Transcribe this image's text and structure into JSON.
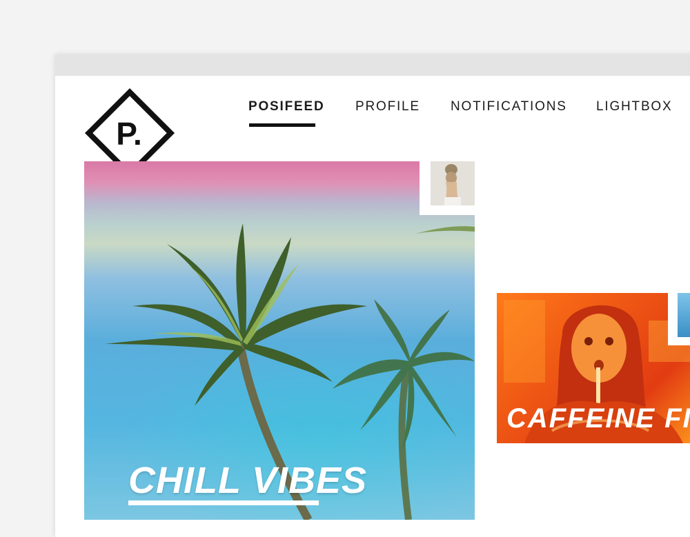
{
  "brand": {
    "logo_letter": "P."
  },
  "nav": {
    "items": [
      {
        "label": "POSIFEED",
        "active": true
      },
      {
        "label": "PROFILE",
        "active": false
      },
      {
        "label": "NOTIFICATIONS",
        "active": false
      },
      {
        "label": "LIGHTBOX",
        "active": false
      }
    ]
  },
  "feed": {
    "cards": [
      {
        "caption": "CHILL VIBES",
        "theme": "palm trees"
      },
      {
        "caption": "CAFFEINE FI",
        "theme": "woman drinking through straw"
      }
    ]
  },
  "colors": {
    "page_bg": "#f3f3f3",
    "titlebar": "#e4e4e4",
    "text": "#1b1b1b",
    "accent_orange": "#f05a14",
    "accent_pink": "#d979a6",
    "sky_blue": "#55b6e0"
  }
}
